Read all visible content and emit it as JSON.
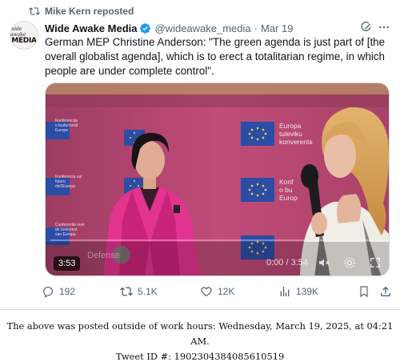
{
  "repost": {
    "text": "Mike Kern reposted",
    "icon": "repost-icon"
  },
  "author": {
    "avatar_text_top": "wide awake",
    "avatar_text_main": "MEDIA",
    "name": "Wide Awake Media",
    "handle": "@wideawake_media",
    "separator": "·",
    "date": "Mar 19"
  },
  "tweet_text": "German MEP Christine Anderson: \"The green agenda is just part of [the overall globalist agenda], which is to erect a totalitarian regime, in which people are under complete control\".",
  "video": {
    "badge_time": "3:53",
    "progress": "0:00 / 3:54",
    "progress_fraction": 0.0,
    "watermark": "Defense",
    "backdrop_right_text": [
      "Europa",
      "tuleviku",
      "konverents"
    ],
    "backdrop_right_text2": [
      "Konf",
      "o bu",
      "Europ"
    ],
    "backdrop_left_text": [
      [
        "Konferencija",
        "o budućnosti",
        "Europe"
      ],
      [
        "Konferenza sul",
        "futuro",
        "dell'Europa"
      ],
      [
        "Conferentie over",
        "de toekomst",
        "van Europa"
      ]
    ],
    "colors": {
      "backdrop": "#b84a72",
      "eu_blue": "#2b4da6",
      "eu_star": "#f5d33f",
      "jacket": "#e2348f"
    }
  },
  "actions": {
    "replies": "192",
    "reposts": "5.1K",
    "likes": "12K",
    "views": "139K"
  },
  "footer": {
    "line1": "The above was posted outside of work hours: Wednesday, March 19, 2025, at 04:21 AM.",
    "line2": "Tweet ID #: 1902304384085610519"
  },
  "colors": {
    "muted": "#536471",
    "verified": "#1d9bf0",
    "text": "#0f1419"
  }
}
